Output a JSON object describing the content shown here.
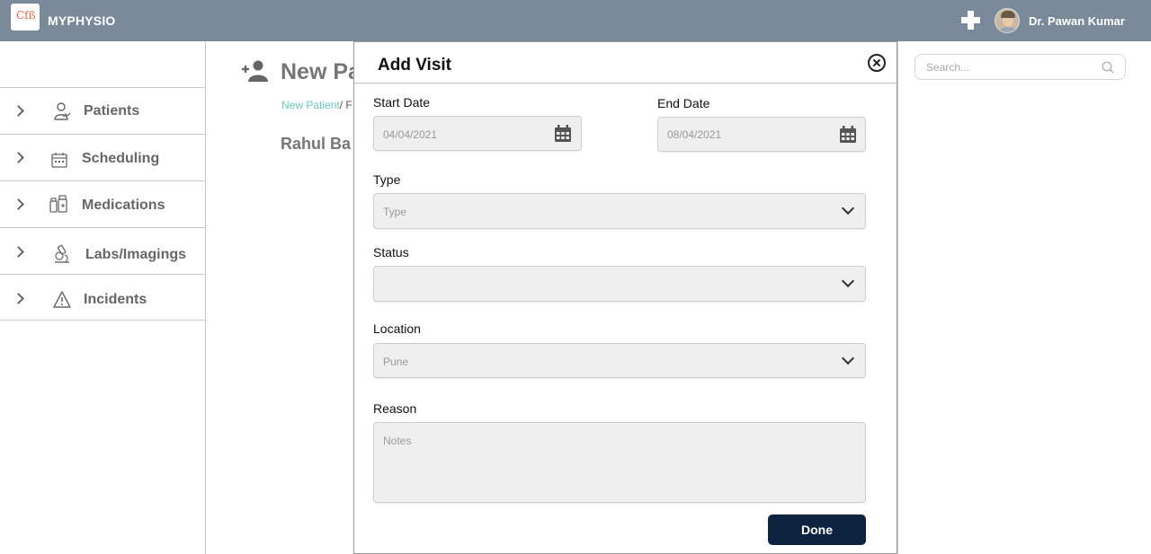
{
  "app": {
    "title": "MYPHYSIO",
    "logo_glyph": "Cfß"
  },
  "header": {
    "user_name": "Dr. Pawan Kumar",
    "add_icon": "plus-icon",
    "avatar": "user-avatar"
  },
  "sidebar": {
    "items": [
      {
        "label": "Patients",
        "icon": "patient-icon"
      },
      {
        "label": "Scheduling",
        "icon": "calendar-icon"
      },
      {
        "label": "Medications",
        "icon": "medication-icon"
      },
      {
        "label": "Labs/Imagings",
        "icon": "microscope-icon"
      },
      {
        "label": "Incidents",
        "icon": "warning-icon"
      }
    ]
  },
  "page": {
    "title": "New Pa",
    "breadcrumb_link": "New Patient",
    "breadcrumb_rest": "/ F",
    "patient_name": "Rahul Ba"
  },
  "search": {
    "placeholder": "Search..."
  },
  "modal": {
    "title": "Add Visit",
    "start_date": {
      "label": "Start Date",
      "value": "04/04/2021"
    },
    "end_date": {
      "label": "End Date",
      "value": "08/04/2021"
    },
    "type": {
      "label": "Type",
      "placeholder": "Type"
    },
    "status": {
      "label": "Status",
      "value": ""
    },
    "location": {
      "label": "Location",
      "value": "Pune"
    },
    "reason": {
      "label": "Reason",
      "placeholder": "Notes"
    },
    "done_label": "Done"
  },
  "colors": {
    "topbar": "#7b8a9b",
    "accent_link": "#6cc8b8",
    "done_button": "#0e2340"
  }
}
